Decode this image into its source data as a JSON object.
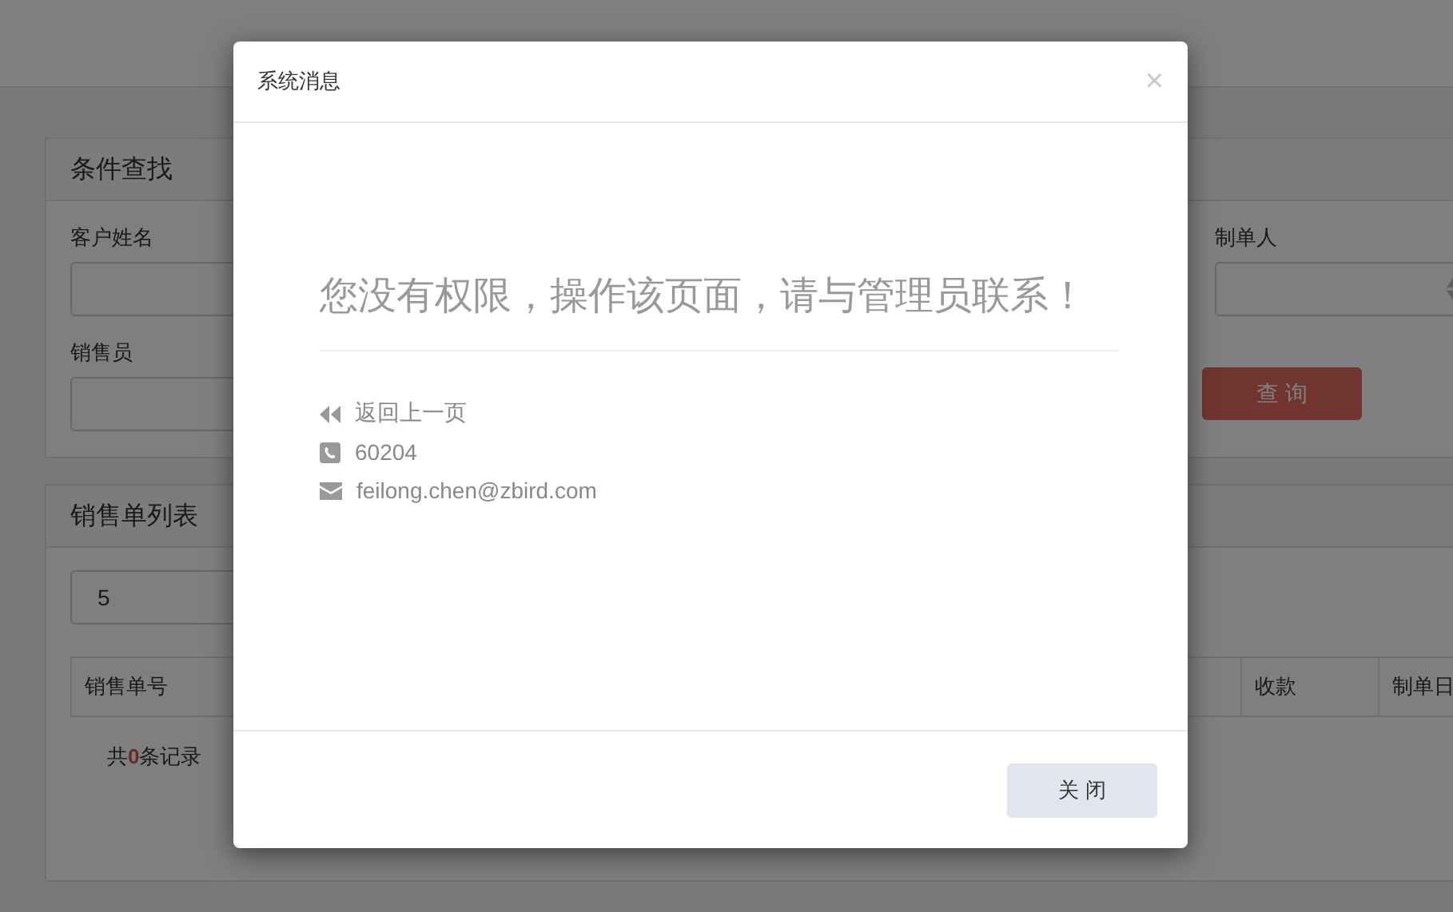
{
  "page": {
    "search_panel": {
      "title": "条件查找",
      "fields": [
        {
          "label": "客户姓名",
          "kind": "text"
        },
        {
          "label": "制单人",
          "kind": "select"
        },
        {
          "label": "销售员",
          "kind": "text"
        }
      ],
      "query_button": "查 询"
    },
    "list_panel": {
      "title": "销售单列表",
      "page_size": "5",
      "columns": [
        "销售单号",
        "收款",
        "制单日"
      ],
      "record_count": "共**0**条记录"
    }
  },
  "dialog": {
    "title": "系统消息",
    "close": "×",
    "message": "您没有权限，操作该页面，请与管理员联系！",
    "links": [
      {
        "kind": "back",
        "text": "返回上一页"
      },
      {
        "kind": "phone",
        "text": "60204"
      },
      {
        "kind": "email",
        "text": "feilong.chen@zbird.com"
      }
    ],
    "close_button": "关 闭"
  }
}
